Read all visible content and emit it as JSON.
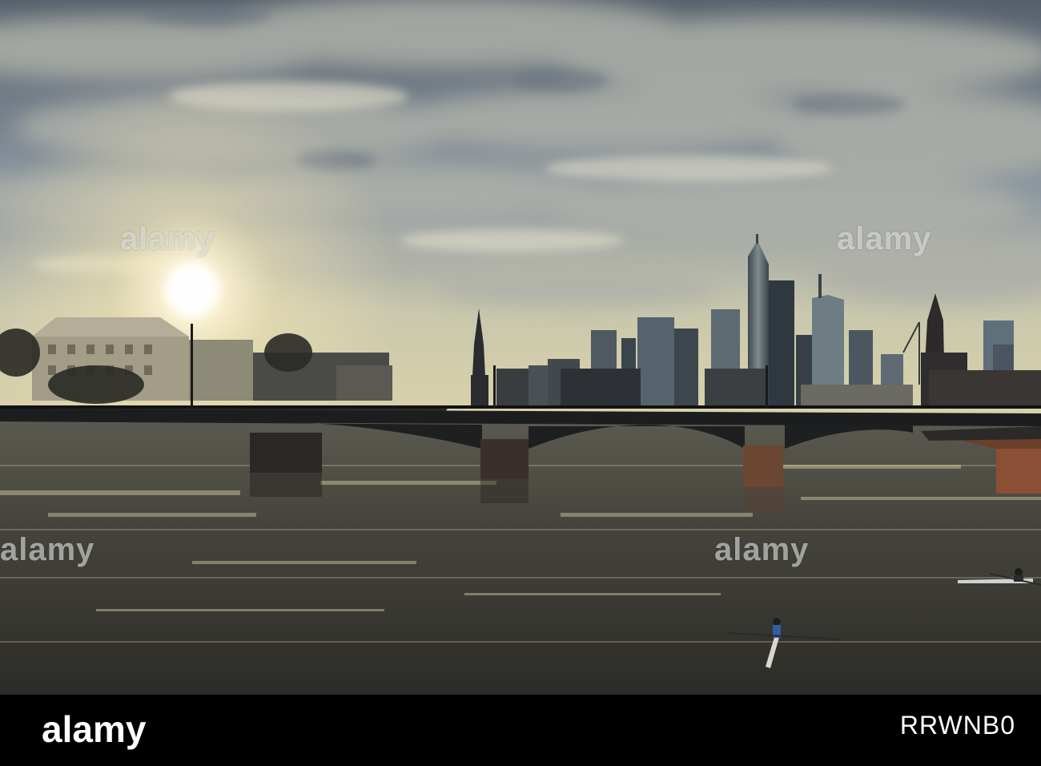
{
  "photo": {
    "scene": "river-bridge-skyline-sunset",
    "colors": {
      "sky_top": "#4d5b6b",
      "sky_glow": "#f4ecc8",
      "clouds": "#a8a9a3",
      "skyline": "#2a3038",
      "bridge": "#1d1e20",
      "water": "#3f3d36",
      "water_glint": "#d6cfa4"
    }
  },
  "watermarks": [
    "alamy",
    "alamy",
    "alamy",
    "alamy"
  ],
  "footer": {
    "logo_text": "alamy",
    "image_id": "RRWNB0",
    "background": "#000000"
  }
}
